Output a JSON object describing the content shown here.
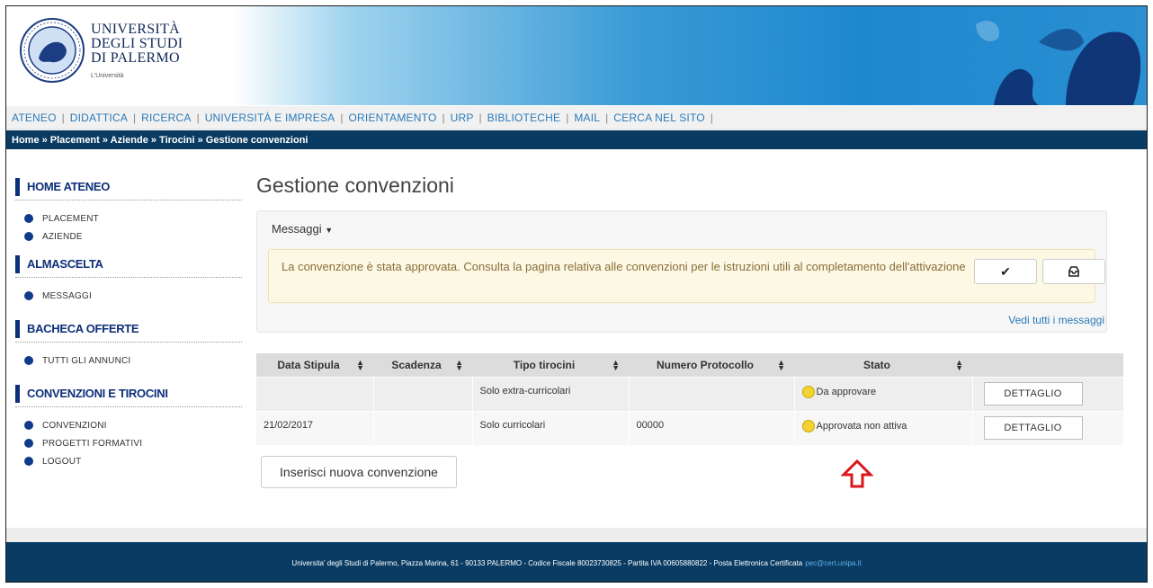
{
  "header": {
    "logo_line1": "UNIVERSITÀ",
    "logo_line2": "DEGLI STUDI",
    "logo_line3": "DI PALERMO",
    "logo_sub": "L'Università"
  },
  "topnav": [
    "ATENEO",
    "DIDATTICA",
    "RICERCA",
    "UNIVERSITÀ E IMPRESA",
    "ORIENTAMENTO",
    "URP",
    "BIBLIOTECHE",
    "MAIL",
    "CERCA NEL SITO"
  ],
  "breadcrumb": "Home » Placement » Aziende » Tirocini » Gestione convenzioni",
  "sidebar": {
    "sections": [
      {
        "title": "HOME ATENEO",
        "items": [
          "PLACEMENT",
          "AZIENDE"
        ]
      },
      {
        "title": "ALMASCELTA",
        "items": [
          "MESSAGGI"
        ]
      },
      {
        "title": "BACHECA OFFERTE",
        "items": [
          "TUTTI GLI ANNUNCI"
        ]
      },
      {
        "title": "CONVENZIONI E TIROCINI",
        "items": [
          "CONVENZIONI",
          "PROGETTI FORMATIVI",
          "LOGOUT"
        ]
      }
    ]
  },
  "main": {
    "title": "Gestione convenzioni",
    "messages": {
      "title": "Messaggi",
      "text": "La convenzione è stata approvata. Consulta la pagina relativa alle convenzioni per le istruzioni utili al completamento dell'attivazione",
      "view_all": "Vedi tutti i messaggi",
      "ack_icon": "check-icon",
      "archive_icon": "inbox-icon"
    },
    "table": {
      "columns": [
        "Data Stipula",
        "Scadenza",
        "Tipo tirocini",
        "Numero Protocollo",
        "Stato",
        ""
      ],
      "rows": [
        {
          "data_stipula": "",
          "scadenza": "",
          "tipo": "Solo extra-curricolari",
          "protocollo": "",
          "stato": "Da approvare",
          "action": "DETTAGLIO"
        },
        {
          "data_stipula": "21/02/2017",
          "scadenza": "",
          "tipo": "Solo curricolari",
          "protocollo": "00000",
          "stato": "Approvata non attiva",
          "action": "DETTAGLIO"
        }
      ]
    },
    "new_button": "Inserisci nuova convenzione"
  },
  "footer": {
    "text": "Universita' degli Studi di Palermo, Piazza Marina, 61 - 90133 PALERMO - Codice Fiscale 80023730825 - Partita IVA 00605880822 - Posta Elettronica Certificata",
    "email": "pec@cert.unipa.it"
  },
  "colors": {
    "navy": "#0a3c63",
    "link": "#2a7ab9",
    "status_yellow": "#f3d232",
    "annotation_red": "#d9161c"
  }
}
